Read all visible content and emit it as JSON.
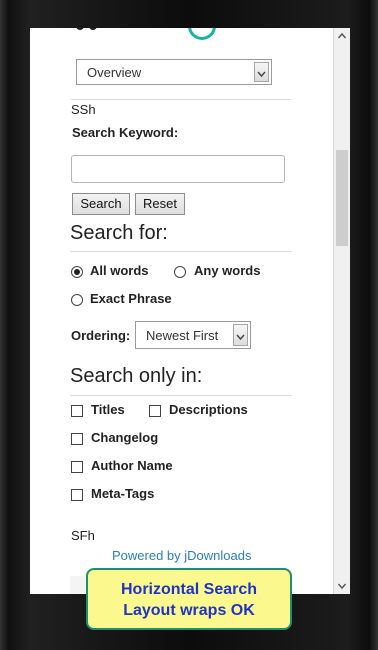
{
  "dropdown": {
    "value": "Overview"
  },
  "ssh_label": "SSh",
  "search_keyword_label": "Search Keyword:",
  "search_input": {
    "value": "",
    "placeholder": ""
  },
  "buttons": {
    "search": "Search",
    "reset": "Reset"
  },
  "search_for_heading": "Search for:",
  "radios": {
    "all_words": "All words",
    "any_words": "Any words",
    "exact_phrase": "Exact Phrase",
    "selected": "all_words"
  },
  "ordering": {
    "label": "Ordering:",
    "value": "Newest First"
  },
  "search_only_heading": "Search only in:",
  "checkboxes": {
    "titles": "Titles",
    "descriptions": "Descriptions",
    "changelog": "Changelog",
    "author_name": "Author Name",
    "meta_tags": "Meta-Tags"
  },
  "sfh_label": "SFh",
  "powered_by": "Powered by jDownloads",
  "callout": {
    "line1": "Horizontal Search",
    "line2": "Layout wraps OK"
  },
  "colors": {
    "link": "#2a7fc0",
    "callout_bg": "#fbf98e",
    "callout_border": "#1e8f73",
    "callout_text": "#1f34c4",
    "logo_accent": "#19b3a0"
  }
}
